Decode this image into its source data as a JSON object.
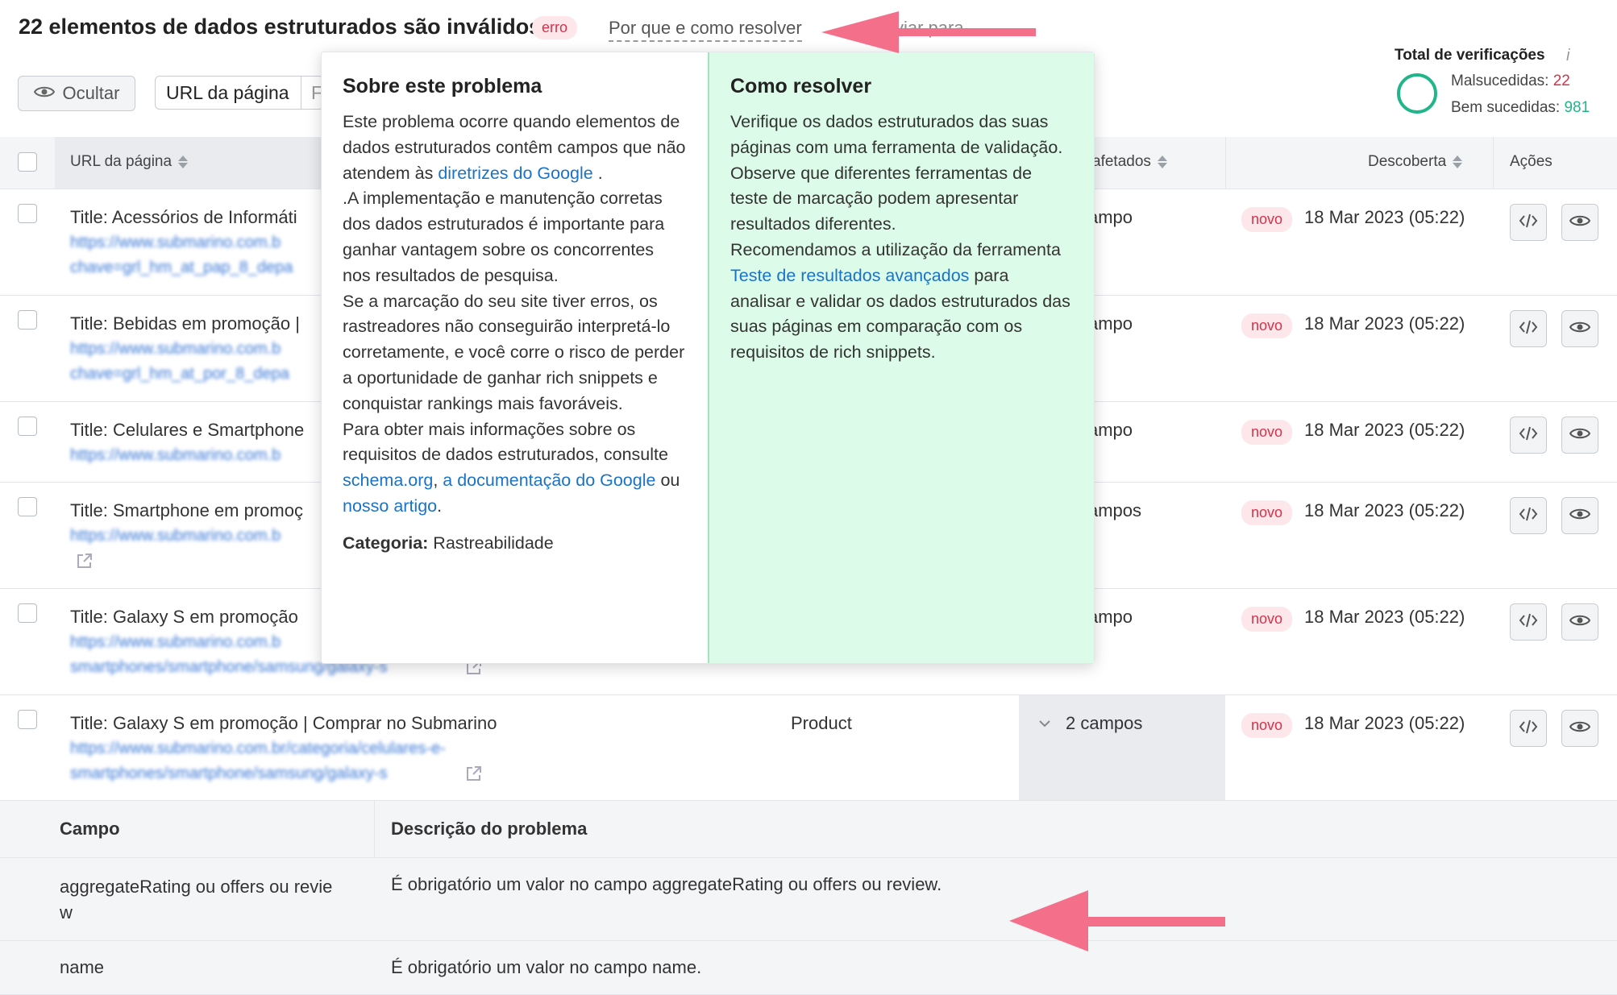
{
  "header": {
    "title": "22 elementos de dados estruturados são inválidos",
    "badge": "erro",
    "why_link": "Por que e como resolver",
    "faded_text": "viar para"
  },
  "toolbar": {
    "hide_label": "Ocultar",
    "filter_label": "URL da página",
    "filter_cut": "F"
  },
  "totals": {
    "title": "Total de verificações",
    "info_icon": "i",
    "failed_label": "Malsucedidas: ",
    "failed_value": "22",
    "success_label": "Bem sucedidas: ",
    "success_value": "981",
    "colors": {
      "failed": "#d6324b",
      "success": "#21b58a"
    }
  },
  "table": {
    "columns": {
      "url": "URL da página",
      "affected": "afetados",
      "discovered": "Descoberta",
      "actions": "Ações"
    },
    "rows": [
      {
        "title": "Title: Acessórios de Informáti",
        "url1": "https://www.submarino.com.b",
        "url2": "chave=grl_hm_at_pap_8_depa",
        "fields": "ampo",
        "status": "novo",
        "date": "18 Mar 2023 (05:22)"
      },
      {
        "title": "Title: Bebidas em promoção |",
        "url1": "https://www.submarino.com.b",
        "url2": "chave=grl_hm_at_por_8_depa",
        "fields": "ampo",
        "status": "novo",
        "date": "18 Mar 2023 (05:22)"
      },
      {
        "title": "Title: Celulares e Smartphone",
        "url1": "https://www.submarino.com.b",
        "url2": "",
        "fields": "ampo",
        "status": "novo",
        "date": "18 Mar 2023 (05:22)"
      },
      {
        "title": "Title: Smartphone em promoç",
        "url1": "https://www.submarino.com.b",
        "url2": "",
        "fields": "ampos",
        "status": "novo",
        "date": "18 Mar 2023 (05:22)"
      },
      {
        "title": "Title: Galaxy S em promoção",
        "url1": "https://www.submarino.com.b",
        "url2": "smartphones/smartphone/samsung/galaxy-s",
        "fields": "ampo",
        "status": "novo",
        "date": "18 Mar 2023 (05:22)"
      },
      {
        "title": "Title: Galaxy S em promoção | Comprar no Submarino",
        "url1": "https://www.submarino.com.br/categoria/celulares-e-",
        "url2": "smartphones/smartphone/samsung/galaxy-s",
        "type": "Product",
        "fields": "2 campos",
        "status": "novo",
        "date": "18 Mar 2023 (05:22)"
      }
    ]
  },
  "popover": {
    "left_title": "Sobre este problema",
    "left_p1a": "Este problema ocorre quando elementos de dados estruturados contêm campos que não atendem às ",
    "left_link1": "diretrizes do Google",
    "left_p1b": " .",
    "left_p2": ".A implementação e manutenção corretas dos dados estruturados é importante para ganhar vantagem sobre os concorrentes nos resultados de pesquisa.",
    "left_p3": "Se a marcação do seu site tiver erros, os rastreadores não conseguirão interpretá-lo corretamente, e você corre o risco de perder a oportunidade de ganhar rich snippets e conquistar rankings mais favoráveis.",
    "left_p4a": "Para obter mais informações sobre os requisitos de dados estruturados, consulte ",
    "left_link2": "schema.org",
    "left_comma": ", ",
    "left_link3": "a documentação do Google",
    "left_ou": " ou ",
    "left_link4": "nosso artigo",
    "left_dot": ".",
    "category_label": "Categoria:",
    "category_value": " Rastreabilidade",
    "right_title": "Como resolver",
    "right_p1": "Verifique os dados estruturados das suas páginas com uma ferramenta de validação. Observe que diferentes ferramentas de teste de marcação podem apresentar resultados diferentes.",
    "right_p2a": "Recomendamos a utilização da ferramenta ",
    "right_link": "Teste de resultados avançados",
    "right_p2b": " para analisar e validar os dados estruturados das suas páginas em comparação com os requisitos de rich snippets."
  },
  "details": {
    "col_field": "Campo",
    "col_desc": "Descrição do problema",
    "rows": [
      {
        "field": "aggregateRating ou offers ou revie\nw",
        "desc": "É obrigatório um valor no campo aggregateRating ou offers ou review."
      },
      {
        "field": "name",
        "desc": "É obrigatório um valor no campo name."
      }
    ]
  },
  "annotation_color": "#f4708a"
}
